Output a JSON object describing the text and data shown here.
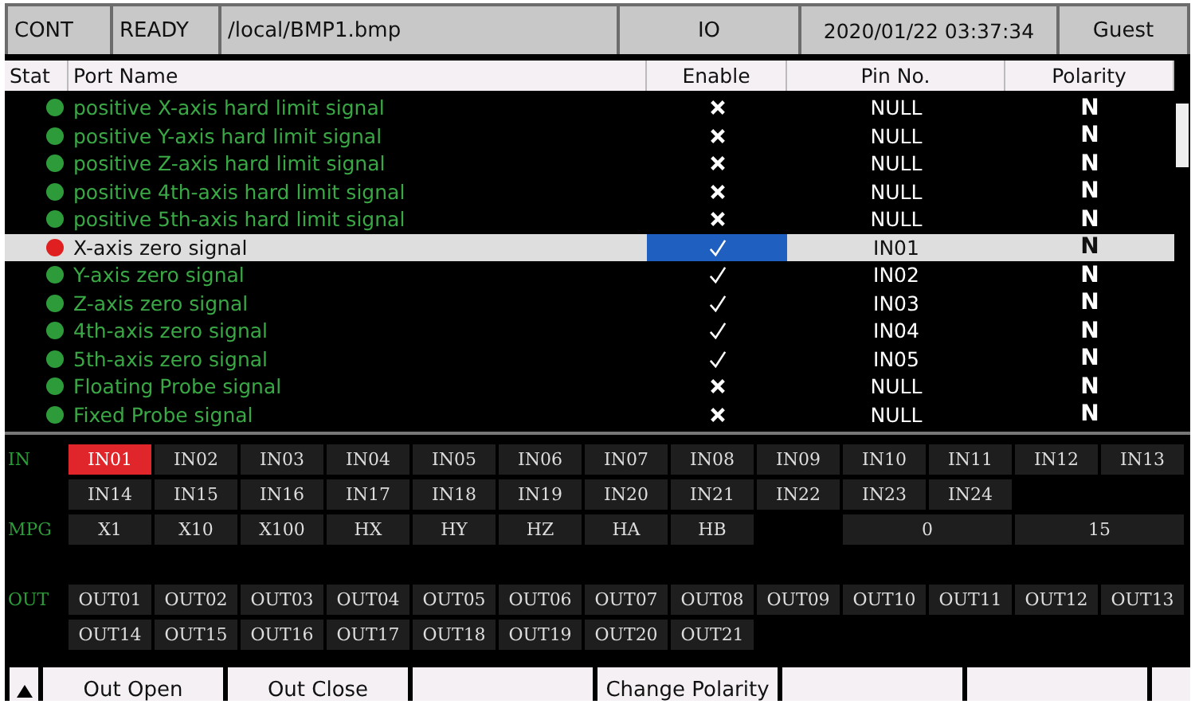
{
  "status_bar": {
    "mode": "CONT",
    "state": "READY",
    "file": "/local/BMP1.bmp",
    "screen": "IO",
    "datetime": "2020/01/22 03:37:34",
    "user": "Guest"
  },
  "table": {
    "columns": [
      "Stat",
      "Port Name",
      "Enable",
      "Pin No.",
      "Polarity"
    ],
    "rows": [
      {
        "color": "#2e9b3a",
        "name": "positive X-axis hard limit signal",
        "enabled": false,
        "pin": "NULL",
        "polarity": "N",
        "selected": false
      },
      {
        "color": "#2e9b3a",
        "name": "positive Y-axis hard limit signal",
        "enabled": false,
        "pin": "NULL",
        "polarity": "N",
        "selected": false
      },
      {
        "color": "#2e9b3a",
        "name": "positive Z-axis hard limit signal",
        "enabled": false,
        "pin": "NULL",
        "polarity": "N",
        "selected": false
      },
      {
        "color": "#2e9b3a",
        "name": "positive 4th-axis hard limit signal",
        "enabled": false,
        "pin": "NULL",
        "polarity": "N",
        "selected": false
      },
      {
        "color": "#2e9b3a",
        "name": "positive 5th-axis hard limit signal",
        "enabled": false,
        "pin": "NULL",
        "polarity": "N",
        "selected": false
      },
      {
        "color": "#e02020",
        "name": "X-axis zero signal",
        "enabled": true,
        "pin": "IN01",
        "polarity": "N",
        "selected": true
      },
      {
        "color": "#2e9b3a",
        "name": "Y-axis zero signal",
        "enabled": true,
        "pin": "IN02",
        "polarity": "N",
        "selected": false
      },
      {
        "color": "#2e9b3a",
        "name": "Z-axis zero signal",
        "enabled": true,
        "pin": "IN03",
        "polarity": "N",
        "selected": false
      },
      {
        "color": "#2e9b3a",
        "name": "4th-axis zero signal",
        "enabled": true,
        "pin": "IN04",
        "polarity": "N",
        "selected": false
      },
      {
        "color": "#2e9b3a",
        "name": "5th-axis zero signal",
        "enabled": true,
        "pin": "IN05",
        "polarity": "N",
        "selected": false
      },
      {
        "color": "#2e9b3a",
        "name": "Floating Probe signal",
        "enabled": false,
        "pin": "NULL",
        "polarity": "N",
        "selected": false
      },
      {
        "color": "#2e9b3a",
        "name": "Fixed Probe signal",
        "enabled": false,
        "pin": "NULL",
        "polarity": "N",
        "selected": false
      }
    ]
  },
  "io_panel": {
    "inputs": {
      "label": "IN",
      "items": [
        {
          "label": "IN01",
          "on": true
        },
        {
          "label": "IN02",
          "on": false
        },
        {
          "label": "IN03",
          "on": false
        },
        {
          "label": "IN04",
          "on": false
        },
        {
          "label": "IN05",
          "on": false
        },
        {
          "label": "IN06",
          "on": false
        },
        {
          "label": "IN07",
          "on": false
        },
        {
          "label": "IN08",
          "on": false
        },
        {
          "label": "IN09",
          "on": false
        },
        {
          "label": "IN10",
          "on": false
        },
        {
          "label": "IN11",
          "on": false
        },
        {
          "label": "IN12",
          "on": false
        },
        {
          "label": "IN13",
          "on": false
        },
        {
          "label": "IN14",
          "on": false
        },
        {
          "label": "IN15",
          "on": false
        },
        {
          "label": "IN16",
          "on": false
        },
        {
          "label": "IN17",
          "on": false
        },
        {
          "label": "IN18",
          "on": false
        },
        {
          "label": "IN19",
          "on": false
        },
        {
          "label": "IN20",
          "on": false
        },
        {
          "label": "IN21",
          "on": false
        },
        {
          "label": "IN22",
          "on": false
        },
        {
          "label": "IN23",
          "on": false
        },
        {
          "label": "IN24",
          "on": false
        }
      ]
    },
    "mpg": {
      "label": "MPG",
      "items": [
        {
          "label": "X1",
          "on": false
        },
        {
          "label": "X10",
          "on": false
        },
        {
          "label": "X100",
          "on": false
        },
        {
          "label": "HX",
          "on": false
        },
        {
          "label": "HY",
          "on": false
        },
        {
          "label": "HZ",
          "on": false
        },
        {
          "label": "HA",
          "on": false
        },
        {
          "label": "HB",
          "on": false
        }
      ],
      "values": [
        "0",
        "15"
      ]
    },
    "outputs": {
      "label": "OUT",
      "items": [
        {
          "label": "OUT01",
          "on": false
        },
        {
          "label": "OUT02",
          "on": false
        },
        {
          "label": "OUT03",
          "on": false
        },
        {
          "label": "OUT04",
          "on": false
        },
        {
          "label": "OUT05",
          "on": false
        },
        {
          "label": "OUT06",
          "on": false
        },
        {
          "label": "OUT07",
          "on": false
        },
        {
          "label": "OUT08",
          "on": false
        },
        {
          "label": "OUT09",
          "on": false
        },
        {
          "label": "OUT10",
          "on": false
        },
        {
          "label": "OUT11",
          "on": false
        },
        {
          "label": "OUT12",
          "on": false
        },
        {
          "label": "OUT13",
          "on": false
        },
        {
          "label": "OUT14",
          "on": false
        },
        {
          "label": "OUT15",
          "on": false
        },
        {
          "label": "OUT16",
          "on": false
        },
        {
          "label": "OUT17",
          "on": false
        },
        {
          "label": "OUT18",
          "on": false
        },
        {
          "label": "OUT19",
          "on": false
        },
        {
          "label": "OUT20",
          "on": false
        },
        {
          "label": "OUT21",
          "on": false
        }
      ]
    }
  },
  "softkeys": [
    {
      "kind": "arrow"
    },
    {
      "kind": "key",
      "label": "Out Open"
    },
    {
      "kind": "key",
      "label": "Out Close"
    },
    {
      "kind": "key"
    },
    {
      "kind": "key",
      "label": "Change Polarity"
    },
    {
      "kind": "key"
    },
    {
      "kind": "key"
    },
    {
      "kind": "stub"
    }
  ]
}
